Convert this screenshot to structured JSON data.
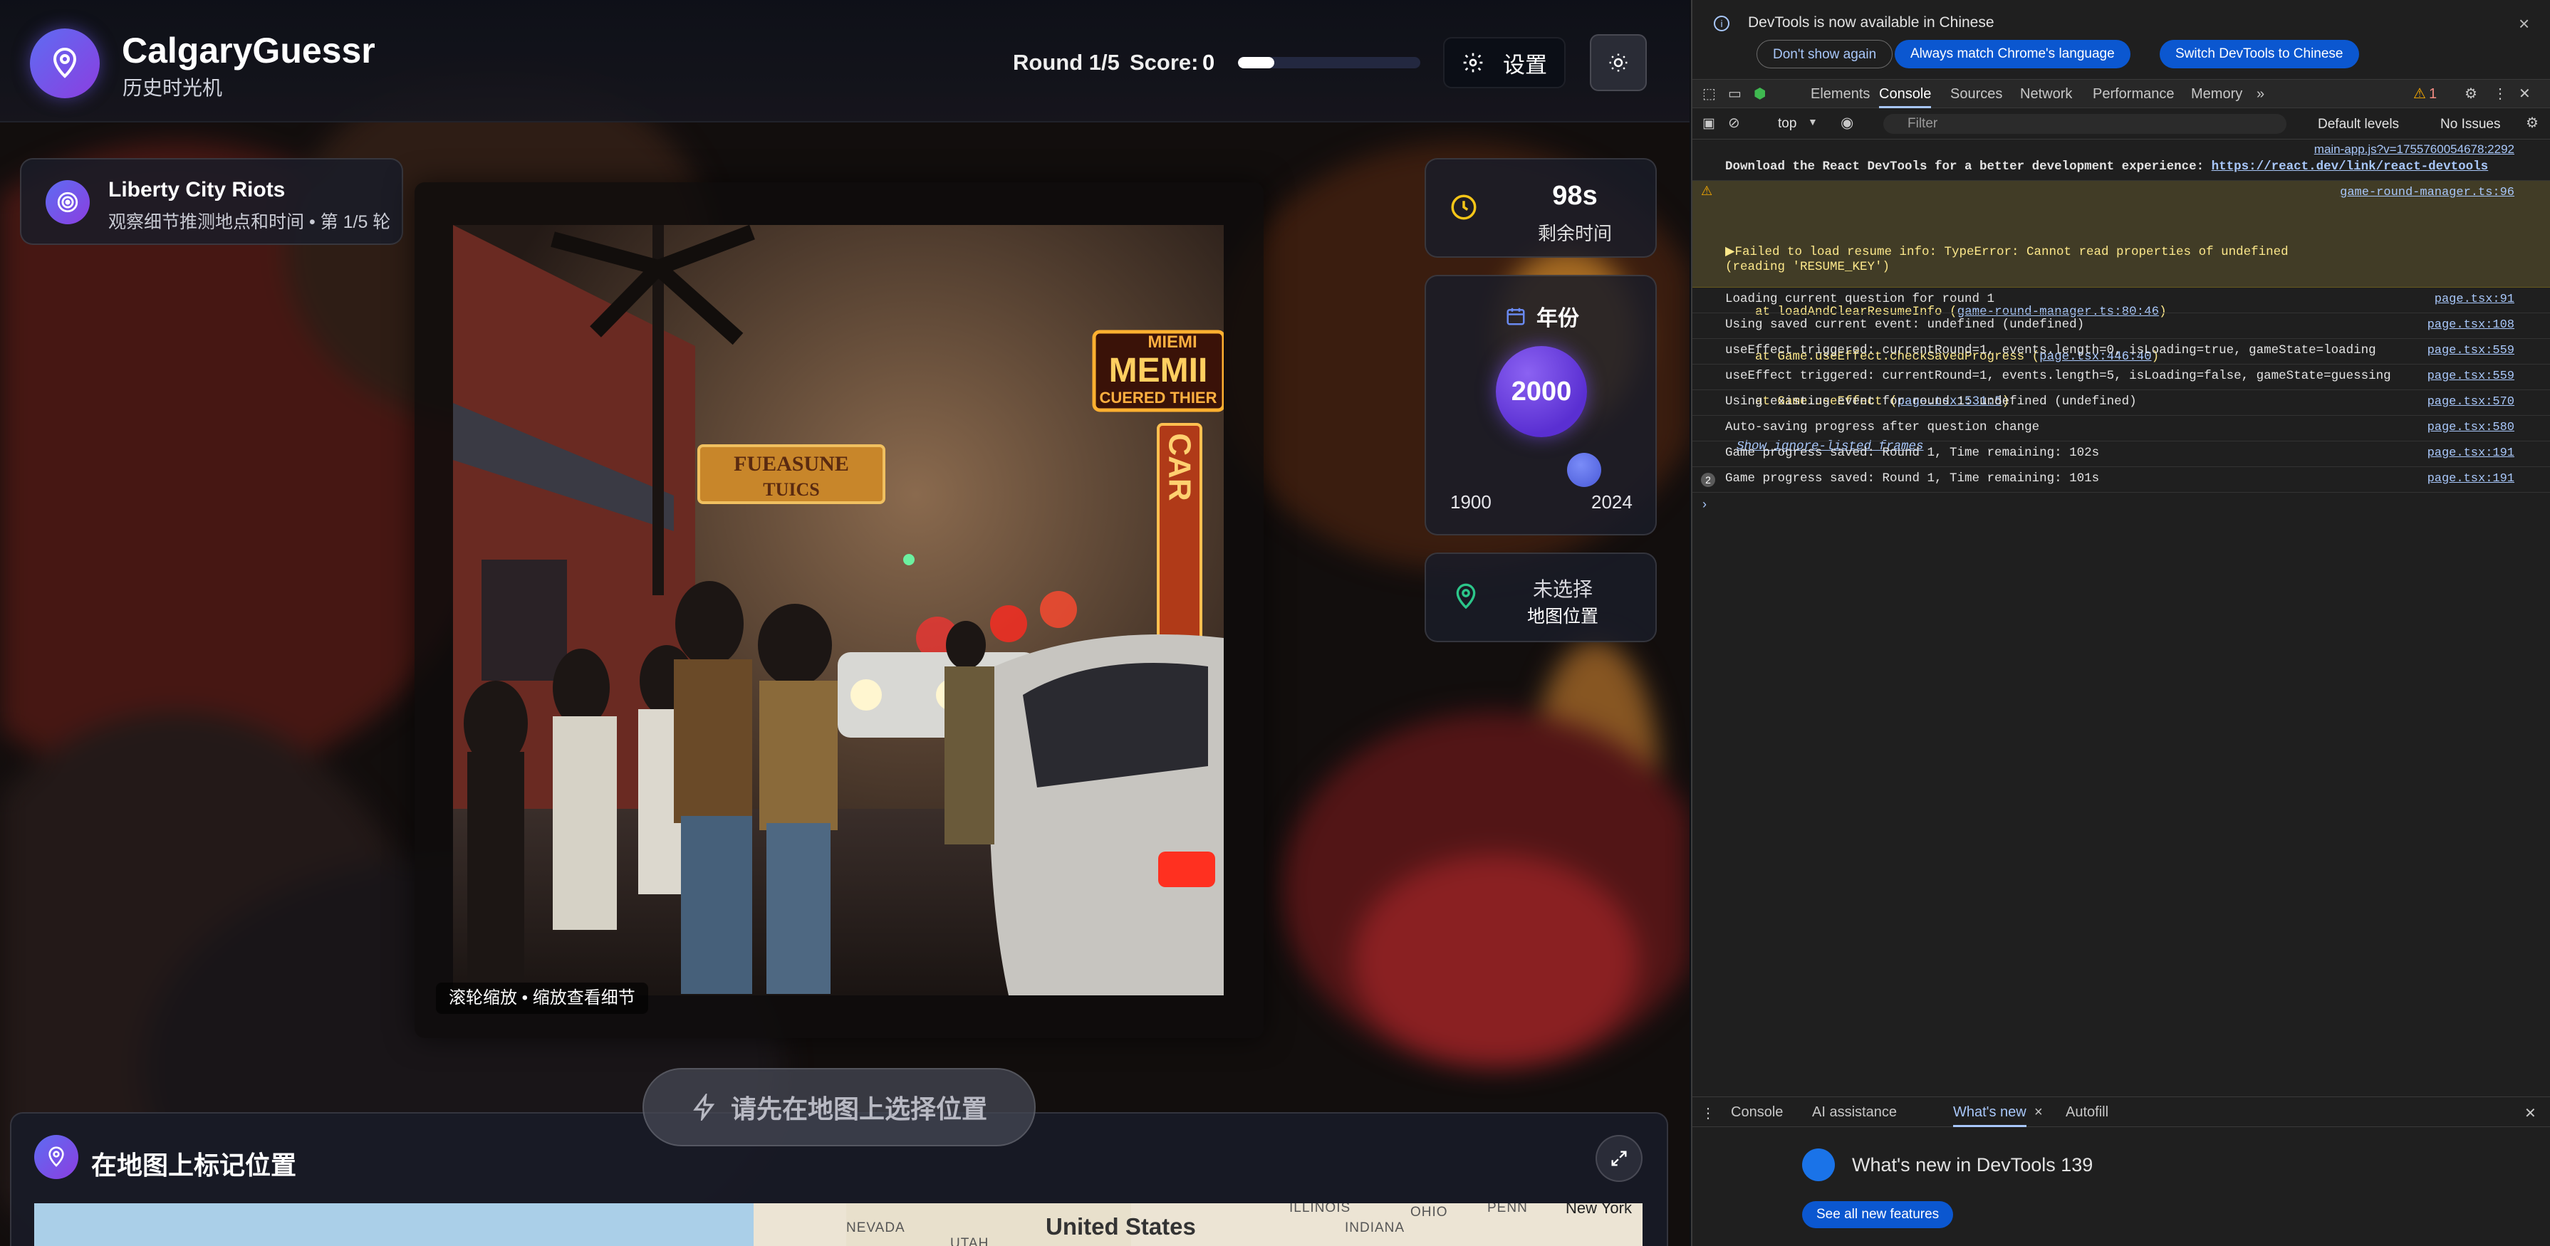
{
  "header": {
    "app_title": "CalgaryGuessr",
    "app_subtitle": "历史时光机",
    "round_text": "Round 1/5",
    "score_label": "Score:",
    "score_value": "0",
    "progress_fraction": 0.2,
    "settings_label": "设置"
  },
  "event": {
    "title": "Liberty City Riots",
    "subtitle": "观察细节推测地点和时间 • 第 1/5 轮"
  },
  "photo": {
    "zoom_hint": "滚轮缩放 • 缩放查看细节",
    "signs": {
      "sign1": "MEMII",
      "sign1_top": "MIEMI",
      "sign1_bottom": "CUERED THIER",
      "sign2": "FUEASUNE",
      "sign2b": "TUICS",
      "sign3": "CAR"
    }
  },
  "timer": {
    "value": "98s",
    "label": "剩余时间"
  },
  "year": {
    "header": "年份",
    "value": "2000",
    "min": "1900",
    "max": "2024"
  },
  "location": {
    "line1": "未选择",
    "line2": "地图位置"
  },
  "submit": {
    "label": "请先在地图上选择位置"
  },
  "map": {
    "title": "在地图上标记位置",
    "labels": {
      "country": "United States",
      "city": "New York",
      "nevada": "NEVADA",
      "utah": "UTAH",
      "illinois": "ILLINOIS",
      "ohio": "OHIO",
      "indiana": "INDIANA",
      "penn": "PENN"
    }
  },
  "devtools": {
    "info_text": "DevTools is now available in Chinese",
    "btn_dont_show": "Don't show again",
    "btn_match": "Always match Chrome's language",
    "btn_switch": "Switch DevTools to Chinese",
    "tabs": [
      "Elements",
      "Console",
      "Sources",
      "Network",
      "Performance",
      "Memory"
    ],
    "warn_count": "1",
    "context": "top",
    "filter_placeholder": "Filter",
    "levels": "Default levels",
    "issues": "No Issues",
    "log": {
      "main_src": "main-app.js?v=1755760054678:2292",
      "react_msg": "Download the React DevTools for a better development experience: ",
      "react_link": "https://react.dev/link/react-devtools",
      "warn_msg": "▶Failed to load resume info: TypeError: Cannot read properties of undefined\n(reading 'RESUME_KEY')",
      "warn_src": "game-round-manager.ts:96",
      "stack1_pre": "    at loadAndClearResumeInfo (",
      "stack1_link": "game-round-manager.ts:80:46",
      "stack2_pre": "    at Game.useEffect.checkSavedProgress (",
      "stack2_link": "page.tsx:446:40",
      "stack3_pre": "    at Game.useEffect (",
      "stack3_link": "page.tsx:531:5",
      "ignore": "Show ignore-listed frames",
      "l1": "Loading current question for round 1",
      "s1": "page.tsx:91",
      "l2": "Using saved current event: undefined (undefined)",
      "s2": "page.tsx:108",
      "l3": "useEffect triggered: currentRound=1, events.length=0, isLoading=true, gameState=loading",
      "s3": "page.tsx:559",
      "l4": "useEffect triggered: currentRound=1, events.length=5, isLoading=false, gameState=guessing",
      "s4": "page.tsx:559",
      "l5": "Using existing event for round 1: undefined (undefined)",
      "s5": "page.tsx:570",
      "l6": "Auto-saving progress after question change",
      "s6": "page.tsx:580",
      "l7": "Game progress saved: Round 1, Time remaining: 102s",
      "s7": "page.tsx:191",
      "l8_count": "2",
      "l8": "Game progress saved: Round 1, Time remaining: 101s",
      "s8": "page.tsx:191"
    },
    "drawer_tabs": [
      "Console",
      "AI assistance",
      "What's new",
      "Autofill"
    ],
    "whats_new_title": "What's new in DevTools 139",
    "whats_new_btn": "See all new features"
  }
}
